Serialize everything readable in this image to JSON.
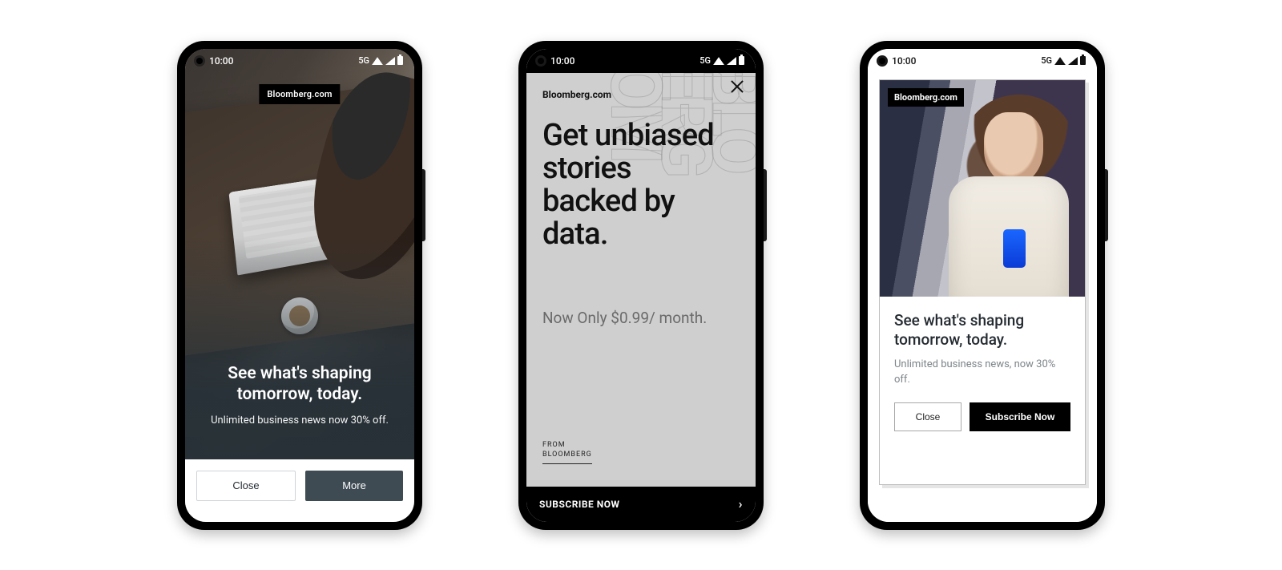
{
  "status": {
    "time": "10:00",
    "network": "5G"
  },
  "brand": "Bloomberg.com",
  "phone1": {
    "headline": "See what's shaping tomorrow, today.",
    "sub": "Unlimited business news now 30% off.",
    "close": "Close",
    "more": "More"
  },
  "phone2": {
    "headline": "Get unbiased stories backed by data.",
    "price": "Now Only $0.99/ month.",
    "from1": "FROM",
    "from2": "BLOOMBERG",
    "cta": "SUBSCRIBE NOW"
  },
  "phone3": {
    "headline": "See what's shaping tomorrow, today.",
    "sub": "Unlimited business news, now 30% off.",
    "close": "Close",
    "subscribe": "Subscribe Now"
  }
}
